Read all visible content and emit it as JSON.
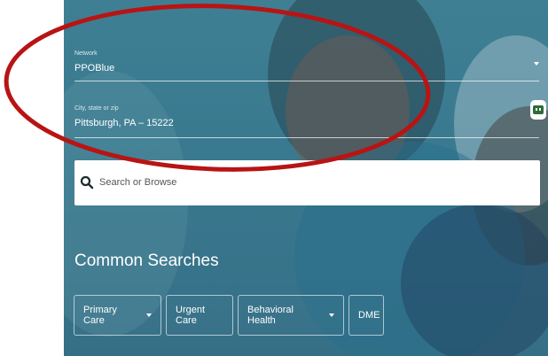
{
  "network": {
    "label": "Network",
    "value": "PPOBlue"
  },
  "location": {
    "label": "City, state or zip",
    "value": "Pittsburgh, PA – 15222"
  },
  "search": {
    "placeholder": "Search or Browse"
  },
  "common_searches": {
    "title": "Common Searches",
    "chips": [
      {
        "label": "Primary Care",
        "has_dropdown": true
      },
      {
        "label": "Urgent Care",
        "has_dropdown": false
      },
      {
        "label": "Behavioral Health",
        "has_dropdown": true
      },
      {
        "label": "DME",
        "has_dropdown": false
      }
    ]
  },
  "icons": {
    "chat": "chat-robot-icon",
    "search": "search-icon",
    "dropdown": "chevron-down-icon"
  },
  "colors": {
    "hero_bg": "#3a7a90",
    "annotation_ellipse": "#b81414",
    "chat_icon_fill": "#2e6b3a"
  }
}
